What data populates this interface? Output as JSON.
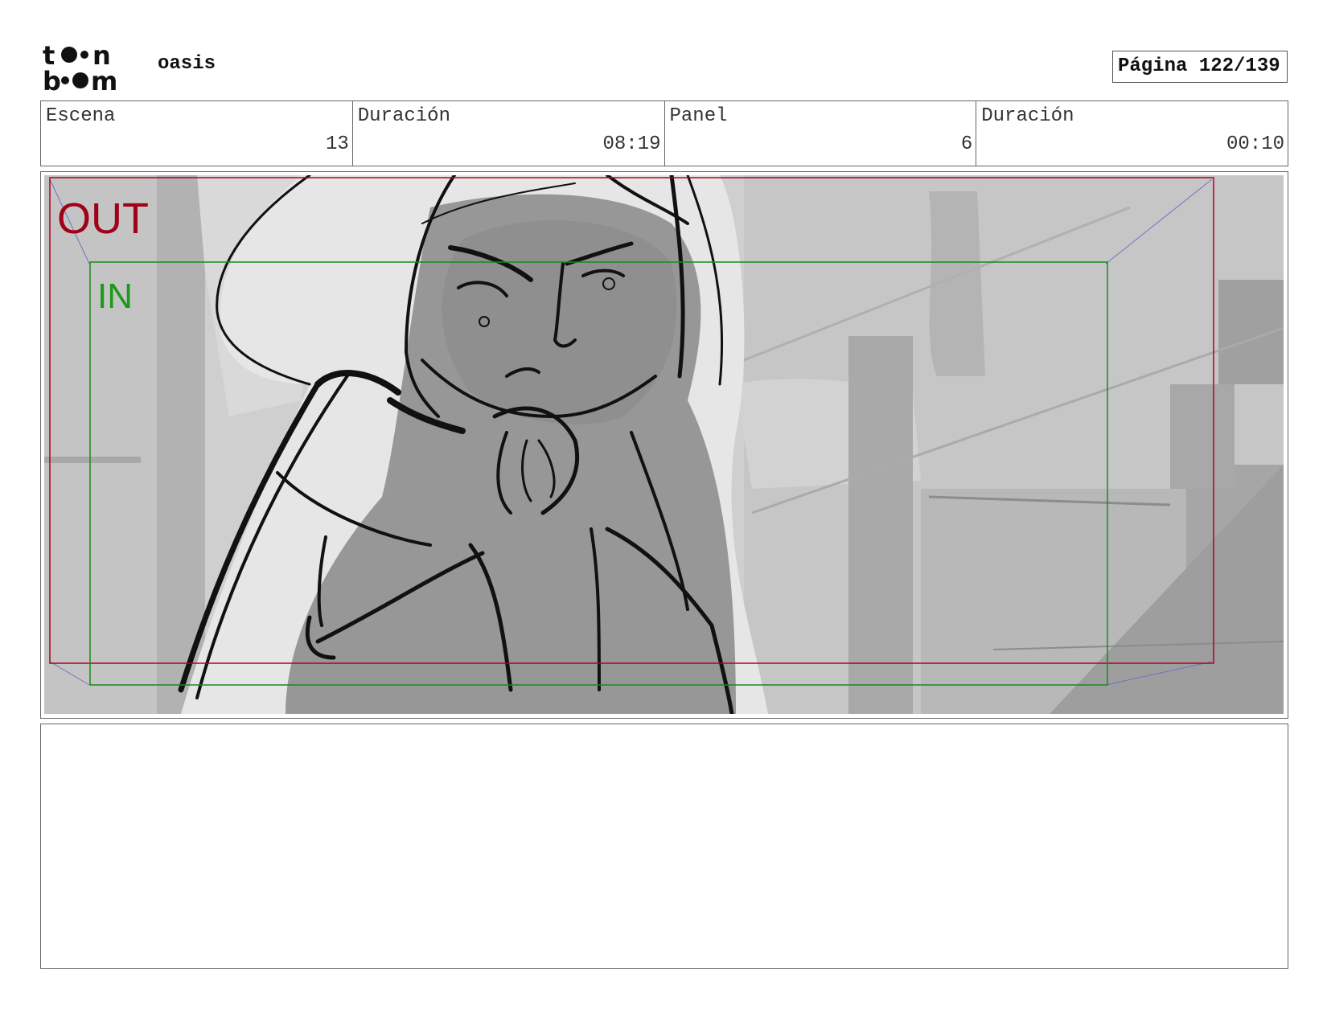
{
  "header": {
    "logo_text": "toon boom",
    "project_title": "oasis",
    "page_label": "Página 122/139"
  },
  "info": {
    "scene_label": "Escena",
    "scene_value": "13",
    "scene_duration_label": "Duración",
    "scene_duration_value": "08:19",
    "panel_label": "Panel",
    "panel_value": "6",
    "panel_duration_label": "Duración",
    "panel_duration_value": "00:10"
  },
  "frame": {
    "out_label": "OUT",
    "in_label": "IN",
    "colors": {
      "out": "#b00020",
      "in": "#1a8a1a",
      "guides": "#7070c8"
    }
  },
  "notes": {
    "text": ""
  }
}
